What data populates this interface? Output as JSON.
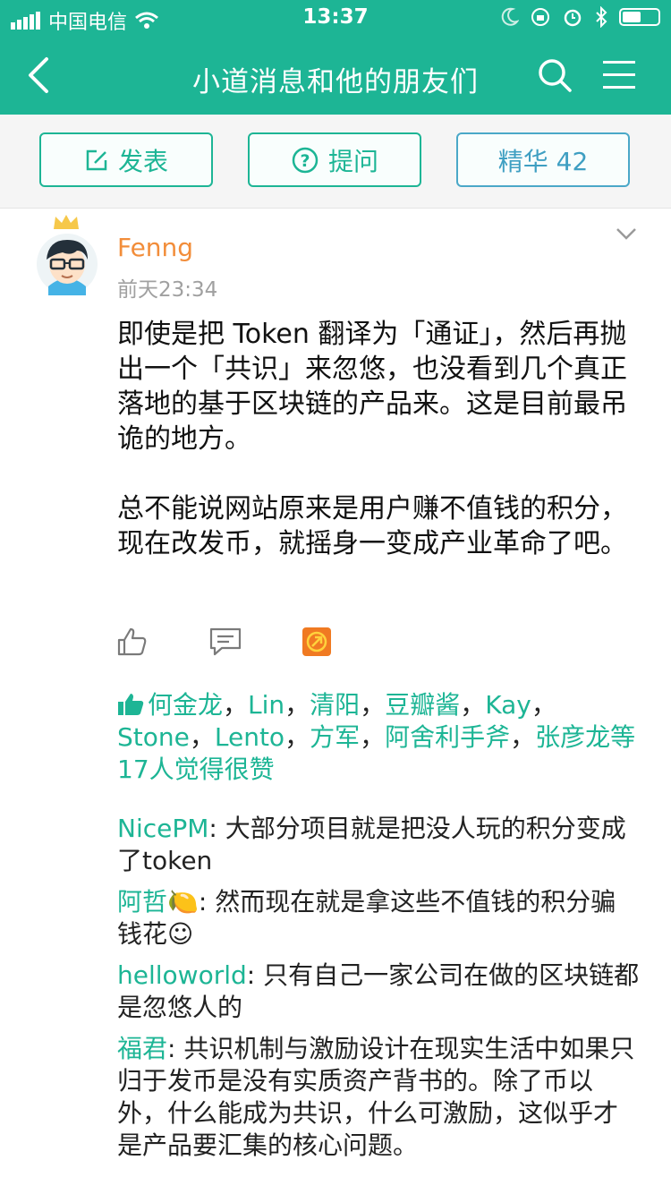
{
  "status_bar": {
    "carrier": "中国电信",
    "time": "13:37"
  },
  "nav": {
    "title": "小道消息和他的朋友们"
  },
  "toolbar": {
    "publish_label": "发表",
    "ask_label": "提问",
    "featured_label": "精华 42"
  },
  "post": {
    "author": "Fenng",
    "time": "前天23:34",
    "paragraphs": [
      "即使是把 Token 翻译为「通证」，然后再抛出一个「共识」来忽悠，也没看到几个真正落地的基于区块链的产品来。这是目前最吊诡的地方。",
      "总不能说网站原来是用户赚不值钱的积分，现在改发币，就摇身一变成产业革命了吧。"
    ],
    "likes": {
      "names": [
        "何金龙",
        "Lin",
        "清阳",
        "豆瓣酱",
        "Kay",
        "Stone",
        "Lento",
        "方军",
        "阿舍利手斧",
        "张彦龙"
      ],
      "separator": "，",
      "suffix": "等17人觉得很赞"
    },
    "comments": [
      {
        "author": "NicePM",
        "colon": ": ",
        "text": "大部分项目就是把没人玩的积分变成了token"
      },
      {
        "author": "阿哲🍋",
        "colon": ": ",
        "text": "然而现在就是拿这些不值钱的积分骗钱花☺"
      },
      {
        "author": "helloworld",
        "colon": ": ",
        "text": "只有自己一家公司在做的区块链都是忽悠人的"
      },
      {
        "author": "福君",
        "colon": ": ",
        "text": "共识机制与激励设计在现实生活中如果只归于发币是没有实质资产背书的。除了币以外，什么能成为共识，什么可激励，这似乎才是产品要汇集的核心问题。"
      }
    ]
  },
  "colors": {
    "brand": "#1db595",
    "author": "#f28d3a",
    "featured": "#3f9fc2"
  }
}
